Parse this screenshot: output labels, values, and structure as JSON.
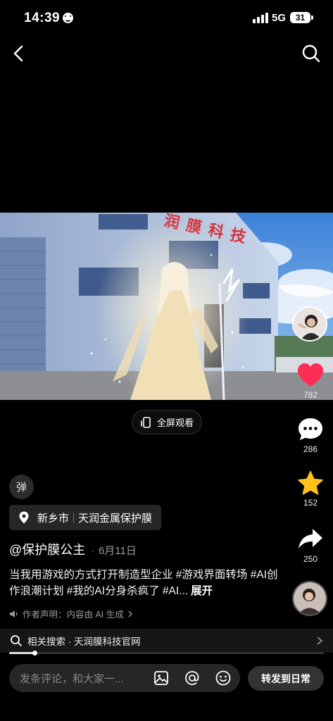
{
  "status_bar": {
    "time": "14:39",
    "network": "5G",
    "battery": "31"
  },
  "video": {
    "building_sign": "润膜科技"
  },
  "fullscreen": {
    "label": "全屏观看"
  },
  "actions": {
    "likes": "782",
    "comments": "286",
    "favorites": "152",
    "shares": "250"
  },
  "colors": {
    "like": "#ff2c55",
    "favorite": "#ffc21a",
    "background": "#000000"
  },
  "danmaku": {
    "label": "弹"
  },
  "location": {
    "city": "新乡市",
    "place": "天润金属保护膜"
  },
  "post": {
    "author": "@保护膜公主",
    "separator": "·",
    "date": "6月11日",
    "caption": "当我用游戏的方式打开制造型企业 #游戏界面转场 #AI创作浪潮计划 #我的AI分身杀疯了 #AI...",
    "expand": "展开",
    "ai_notice": "作者声明：内容由 AI 生成"
  },
  "related_search": {
    "label": "相关搜索 · 天润膜科技官网"
  },
  "playback": {
    "progress": 0.08
  },
  "comment_bar": {
    "placeholder": "发条评论，和大家一...",
    "share_daily": "转发到日常"
  }
}
